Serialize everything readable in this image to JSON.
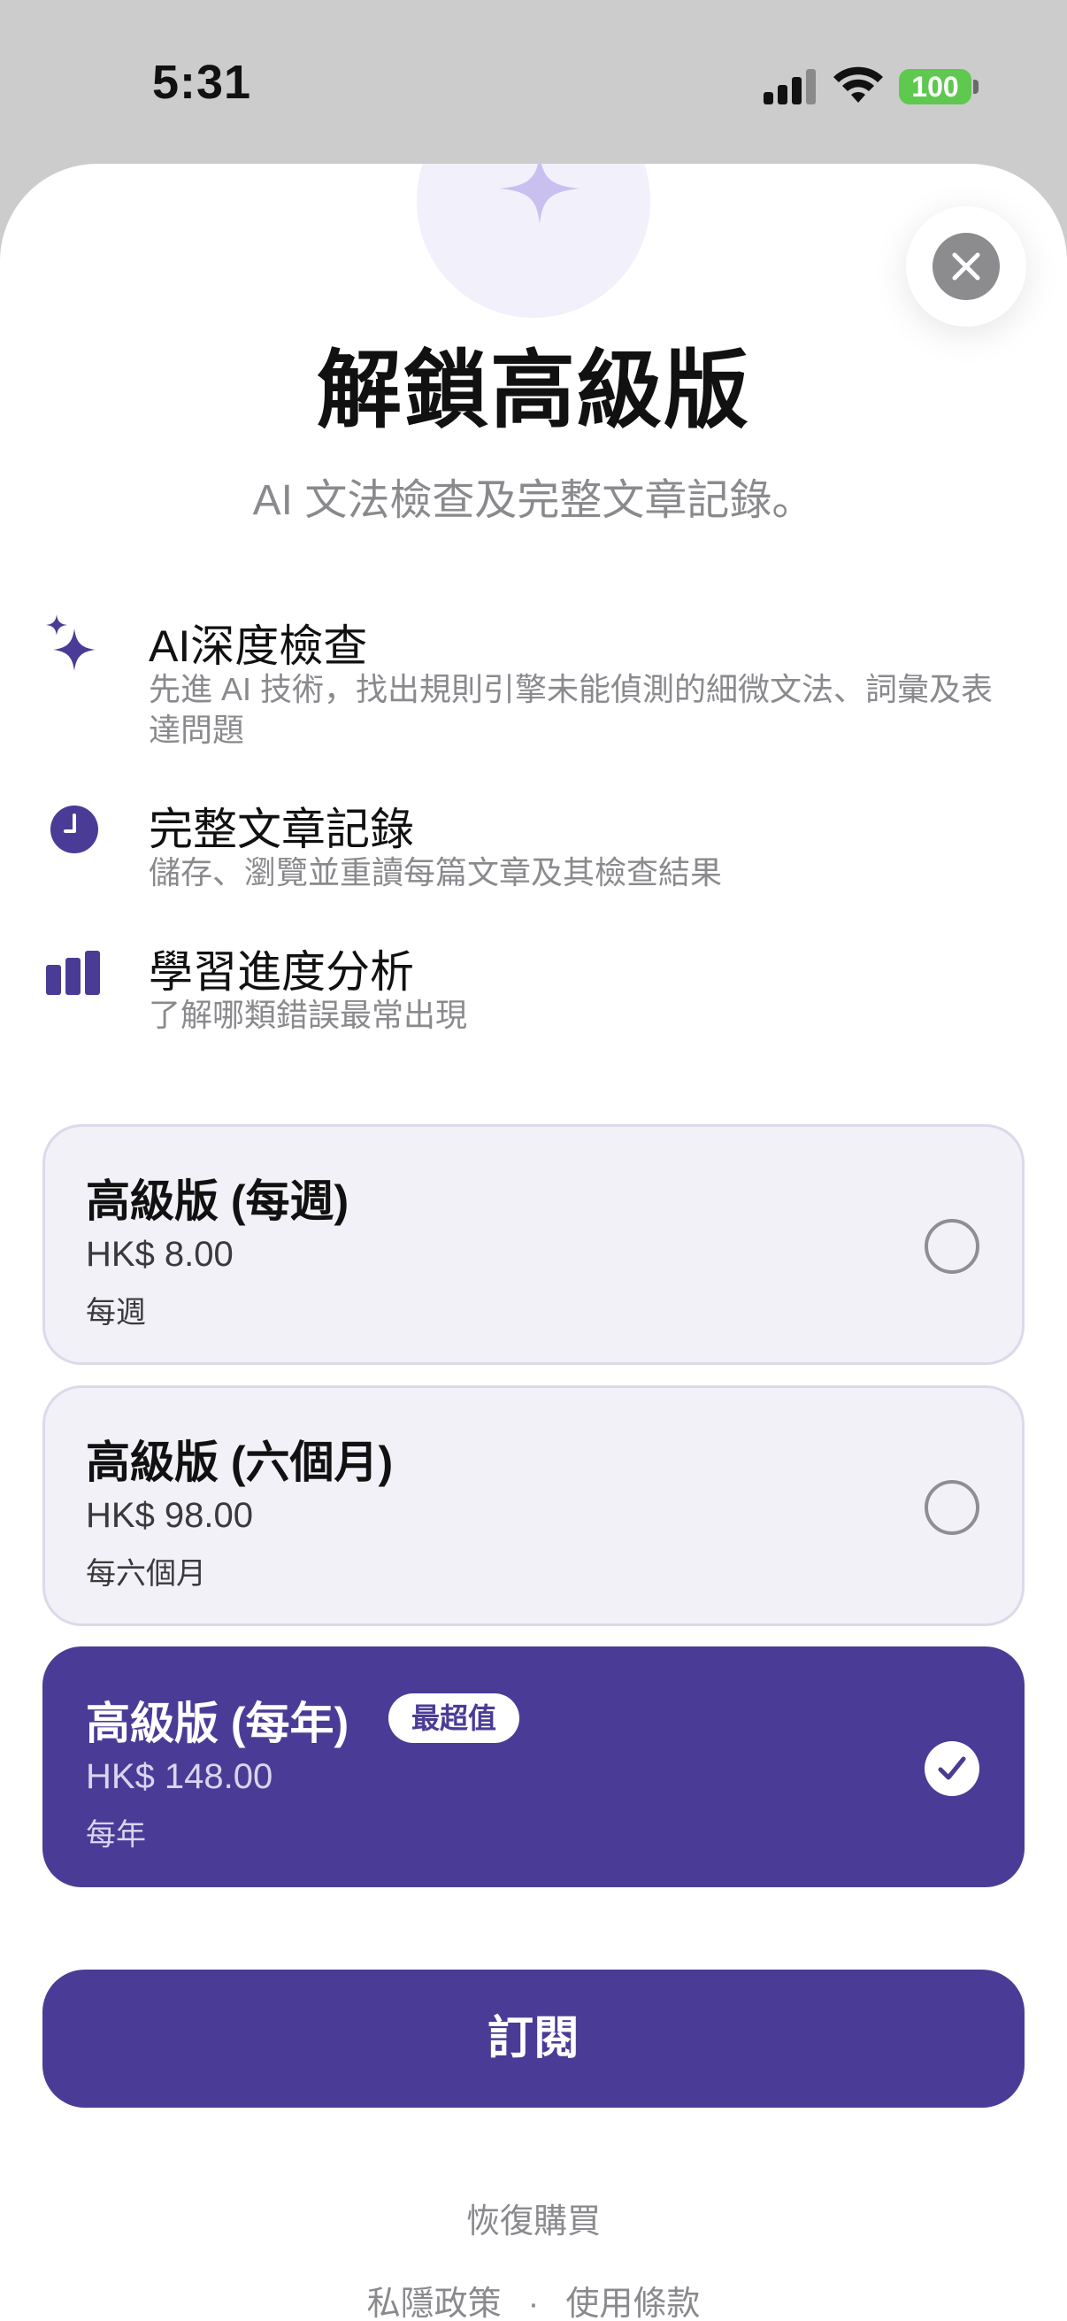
{
  "status_bar": {
    "time": "5:31",
    "battery": "100"
  },
  "header": {
    "title": "解鎖高級版",
    "subtitle": "AI 文法檢查及完整文章記錄。"
  },
  "features": [
    {
      "icon": "sparkles-icon",
      "title": "AI深度檢查",
      "desc": "先進 AI 技術，找出規則引擎未能偵測的細微文法、詞彙及表達問題"
    },
    {
      "icon": "clock-icon",
      "title": "完整文章記錄",
      "desc": "儲存、瀏覽並重讀每篇文章及其檢查結果"
    },
    {
      "icon": "bar-chart-icon",
      "title": "學習進度分析",
      "desc": "了解哪類錯誤最常出現"
    }
  ],
  "plans": [
    {
      "name": "高級版 (每週)",
      "price": "HK$ 8.00",
      "period": "每週",
      "selected": false
    },
    {
      "name": "高級版 (六個月)",
      "price": "HK$ 98.00",
      "period": "每六個月",
      "selected": false
    },
    {
      "name": "高級版 (每年)",
      "price": "HK$ 148.00",
      "period": "每年",
      "selected": true,
      "badge": "最超值"
    }
  ],
  "actions": {
    "subscribe": "訂閱",
    "restore": "恢復購買",
    "privacy": "私隱政策",
    "separator": "·",
    "terms": "使用條款"
  },
  "colors": {
    "accent": "#4a3c96",
    "battery": "#5fc84f"
  }
}
